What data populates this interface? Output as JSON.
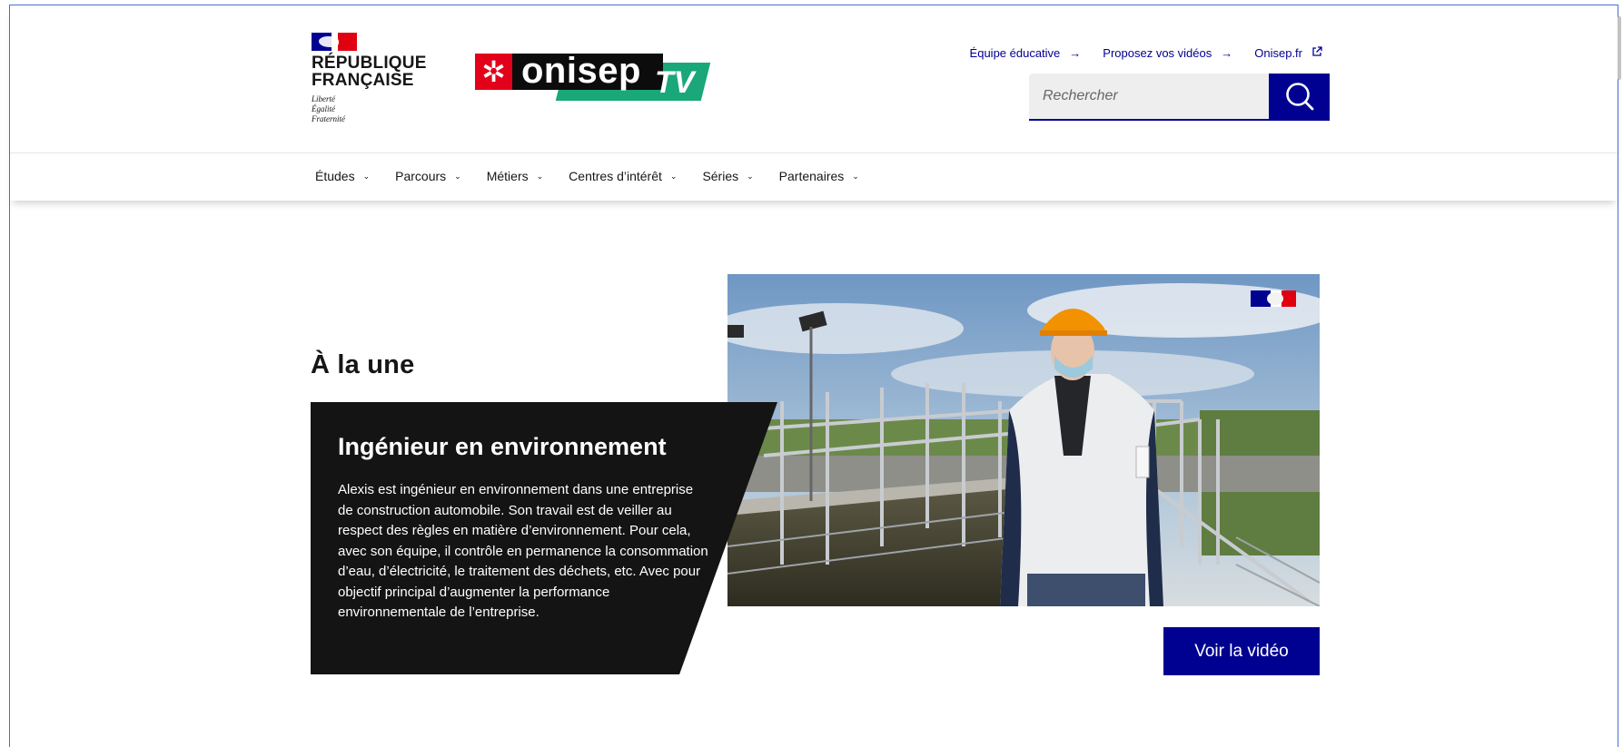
{
  "header": {
    "republic_lines": [
      "République",
      "Française"
    ],
    "devise": [
      "Liberté",
      "Égalité",
      "Fraternité"
    ],
    "logo": {
      "mark": "✲",
      "word": "onisep",
      "suffix": "TV"
    },
    "top_links": [
      {
        "label": "Équipe éducative",
        "icon": "arrow-right-icon"
      },
      {
        "label": "Proposez vos vidéos",
        "icon": "arrow-right-icon"
      },
      {
        "label": "Onisep.fr",
        "icon": "external-link-icon"
      }
    ],
    "search": {
      "placeholder": "Rechercher",
      "value": ""
    }
  },
  "nav": {
    "items": [
      {
        "label": "Études"
      },
      {
        "label": "Parcours"
      },
      {
        "label": "Métiers"
      },
      {
        "label": "Centres d’intérêt"
      },
      {
        "label": "Séries"
      },
      {
        "label": "Partenaires"
      }
    ]
  },
  "hero": {
    "section_title": "À la une",
    "card_title": "Ingénieur en environnement",
    "card_description": "Alexis est ingénieur en environnement dans une entreprise de construction automobile. Son travail est de veiller au respect des règles en matière d’environnement. Pour cela, avec son équipe, il contrôle en permanence la consommation d’eau, d’électricité, le traitement des déchets, etc. Avec pour objectif principal d’augmenter la performance environnementale de l’entreprise.",
    "cta_label": "Voir la vidéo"
  },
  "colors": {
    "primary_blue": "#000091",
    "flag_red": "#e1000f",
    "onisep_red": "#e2001a",
    "onisep_green": "#1aa779",
    "card_bg": "#141414"
  }
}
